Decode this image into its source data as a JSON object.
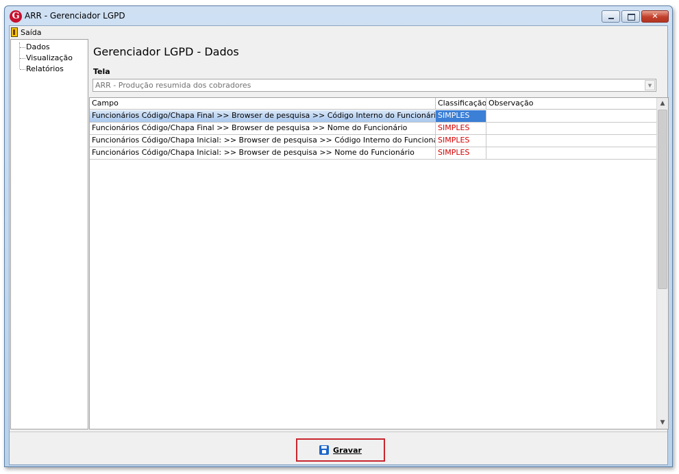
{
  "window": {
    "title": "ARR - Gerenciador LGPD",
    "logo_letter": "G"
  },
  "menu": {
    "exit_label": "Saída"
  },
  "sidebar": {
    "items": [
      {
        "label": "Dados"
      },
      {
        "label": "Visualização"
      },
      {
        "label": "Relatórios"
      }
    ]
  },
  "main": {
    "title": "Gerenciador LGPD - Dados",
    "tela_label": "Tela",
    "tela_value": "ARR - Produção resumida dos cobradores"
  },
  "grid": {
    "columns": [
      "Campo",
      "Classificação",
      "Observação"
    ],
    "rows": [
      {
        "campo": "Funcionários Código/Chapa Final >> Browser de pesquisa >> Código Interno do Funcionário",
        "classificacao": "SIMPLES",
        "observacao": "",
        "selected": true
      },
      {
        "campo": "Funcionários Código/Chapa Final >> Browser de pesquisa >> Nome do Funcionário",
        "classificacao": "SIMPLES",
        "observacao": ""
      },
      {
        "campo": "Funcionários Código/Chapa Inicial: >> Browser de pesquisa >> Código Interno do Funcionário",
        "classificacao": "SIMPLES",
        "observacao": ""
      },
      {
        "campo": "Funcionários Código/Chapa Inicial: >> Browser de pesquisa >> Nome do Funcionário",
        "classificacao": "SIMPLES",
        "observacao": ""
      }
    ]
  },
  "footer": {
    "save_label": "Gravar"
  },
  "colors": {
    "classification_text": "#d40000",
    "selection_accent": "#3b7fd6",
    "highlight_border": "#c8242d"
  }
}
